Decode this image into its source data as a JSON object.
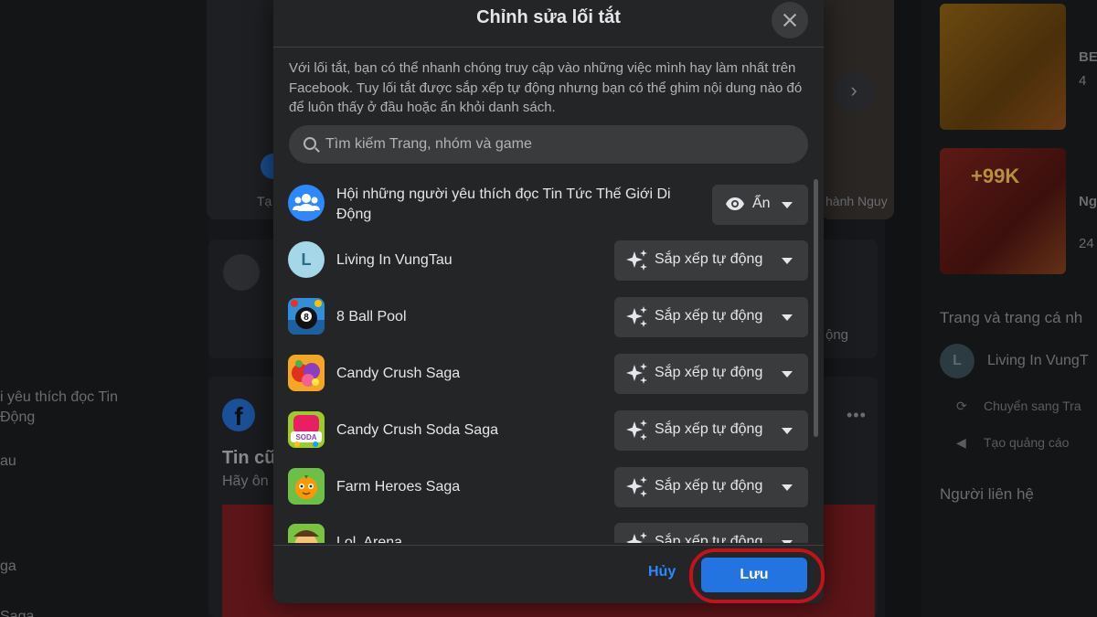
{
  "modal": {
    "title": "Chỉnh sửa lối tắt",
    "description": "Với lối tắt, bạn có thể nhanh chóng truy cập vào những việc mình hay làm nhất trên Facebook. Tuy lối tắt được sắp xếp tự động nhưng bạn có thể ghim nội dung nào đó để luôn thấy ở đầu hoặc ẩn khỏi danh sách.",
    "search_placeholder": "Tìm kiếm Trang, nhóm và game",
    "shortcuts": [
      {
        "name": "Hội những người yêu thích đọc Tin Tức Thế Giới Di Động",
        "name_line1": "Hội những người yêu thích đọc Tin Tức Thế Giới Di",
        "name_line2": "Động",
        "setting": "Ẩn",
        "icon": "group-icon"
      },
      {
        "name": "Living In VungTau",
        "setting": "Sắp xếp tự động",
        "icon": "page-letter-avatar",
        "avatar_letter": "L"
      },
      {
        "name": "8 Ball Pool",
        "setting": "Sắp xếp tự động",
        "icon": "8-ball-pool-game-icon"
      },
      {
        "name": "Candy Crush Saga",
        "setting": "Sắp xếp tự động",
        "icon": "candy-crush-game-icon"
      },
      {
        "name": "Candy Crush Soda Saga",
        "setting": "Sắp xếp tự động",
        "icon": "candy-crush-soda-game-icon"
      },
      {
        "name": "Farm Heroes Saga",
        "setting": "Sắp xếp tự động",
        "icon": "farm-heroes-game-icon"
      },
      {
        "name": "Lol. Arena",
        "setting": "Sắp xếp tự động",
        "icon": "lol-arena-game-icon"
      }
    ],
    "cancel_label": "Hủy",
    "save_label": "Lưu"
  },
  "background": {
    "left_sidebar": [
      "i yêu thích đọc Tin",
      "Động",
      "au",
      "ga",
      "Saga"
    ],
    "story_labels": [
      "Tạ",
      "hành Nguy"
    ],
    "news_title": "Tin cũ",
    "news_sub": "Hãy ôn",
    "dim_action": "ộng",
    "right_ad_sides": [
      "BE",
      "4",
      "Ng",
      "24"
    ],
    "ad_badge": "+99K",
    "right_section_title": "Trang và trang cá nh",
    "page_avatar_letter": "L",
    "page_name": "Living In VungT",
    "page_actions": [
      "Chuyển sang Tra",
      "Tạo quảng cáo"
    ],
    "contacts_title": "Người liên hệ"
  },
  "colors": {
    "accent": "#2374e1",
    "link": "#2d88ff",
    "modal_bg": "#242526",
    "control_bg": "#3a3b3c",
    "highlight_ring": "#c3121b"
  }
}
